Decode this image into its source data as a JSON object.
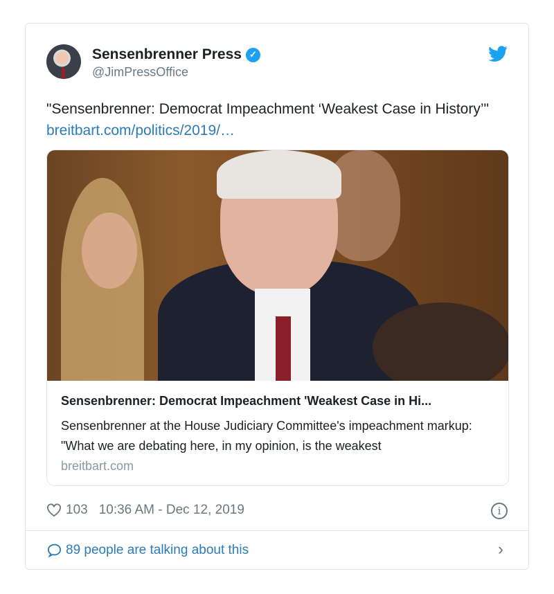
{
  "author": {
    "name": "Sensenbrenner Press",
    "handle": "@JimPressOffice",
    "verified": true
  },
  "tweet": {
    "text": "\"Sensenbrenner: Democrat Impeachment ‘Weakest Case in History’\"",
    "link": "breitbart.com/politics/2019/…"
  },
  "link_card": {
    "title": "Sensenbrenner: Democrat Impeachment 'Weakest Case in Hi...",
    "description": "Sensenbrenner at the House Judiciary Committee's impeachment markup: \"What we are debating here, in my opinion, is the weakest",
    "domain": "breitbart.com"
  },
  "footer": {
    "likes": "103",
    "timestamp": "10:36 AM - Dec 12, 2019",
    "talking": "89 people are talking about this"
  },
  "colors": {
    "accent": "#1da1f2",
    "link": "#2b7bb9",
    "muted": "#697882"
  },
  "icons": [
    "verified-badge-icon",
    "twitter-bird-icon",
    "heart-icon",
    "info-icon",
    "comment-icon",
    "chevron-right-icon"
  ]
}
